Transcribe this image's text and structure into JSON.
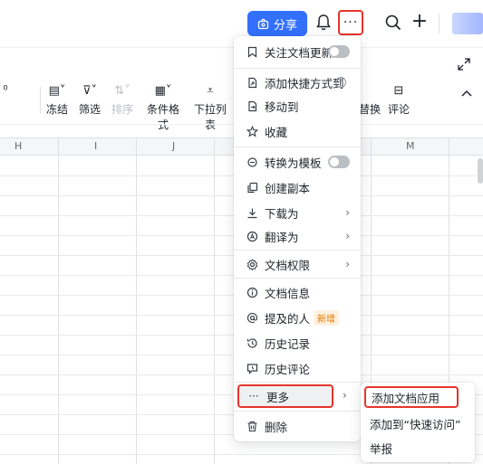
{
  "header": {
    "share_label": "分享",
    "more_glyph": "···",
    "plus_glyph": "+"
  },
  "toolbar": {
    "items": [
      {
        "label": "冻结"
      },
      {
        "label": "筛选"
      },
      {
        "label": "排序"
      },
      {
        "label": "条件格式"
      },
      {
        "label": "下拉列表"
      },
      {
        "label": "替换"
      },
      {
        "label": "评论"
      }
    ]
  },
  "grid": {
    "columns": [
      "H",
      "I",
      "J",
      "M"
    ]
  },
  "menu": {
    "items": [
      {
        "label": "关注文档更新",
        "icon": "bookmark-icon",
        "toggle": "off"
      },
      {
        "label": "添加快捷方式到",
        "icon": "shortcut-icon",
        "help": "?"
      },
      {
        "label": "移动到",
        "icon": "move-icon"
      },
      {
        "label": "收藏",
        "icon": "star-icon"
      },
      {
        "label": "转换为模板",
        "icon": "template-icon",
        "toggle": "off"
      },
      {
        "label": "创建副本",
        "icon": "copy-icon"
      },
      {
        "label": "下载为",
        "icon": "download-icon",
        "arrow": "›"
      },
      {
        "label": "翻译为",
        "icon": "translate-icon",
        "arrow": "›"
      },
      {
        "label": "文档权限",
        "icon": "gear-icon",
        "arrow": "›"
      },
      {
        "label": "文档信息",
        "icon": "info-icon"
      },
      {
        "label": "提及的人",
        "icon": "at-icon",
        "badge": "新增"
      },
      {
        "label": "历史记录",
        "icon": "history-icon"
      },
      {
        "label": "历史评论",
        "icon": "comment-history-icon"
      },
      {
        "label": "更多",
        "icon": "more-dots-icon",
        "arrow": "›"
      },
      {
        "label": "删除",
        "icon": "trash-icon"
      }
    ]
  },
  "submenu": {
    "items": [
      {
        "label": "添加文档应用"
      },
      {
        "label": "添加到“快速访问”"
      },
      {
        "label": "举报"
      }
    ]
  },
  "colors": {
    "accent": "#3370ff",
    "highlight": "#e5352b",
    "badge_text": "#de7802",
    "badge_bg": "#fff1e0"
  }
}
